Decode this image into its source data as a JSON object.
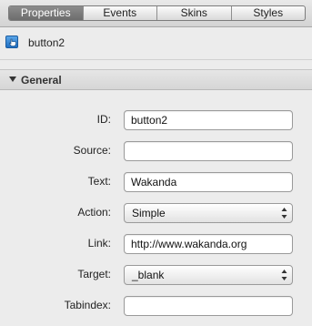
{
  "tabs": [
    {
      "label": "Properties",
      "active": true
    },
    {
      "label": "Events",
      "active": false
    },
    {
      "label": "Skins",
      "active": false
    },
    {
      "label": "Styles",
      "active": false
    }
  ],
  "element": {
    "name": "button2",
    "icon": "button-widget-icon"
  },
  "section": {
    "title": "General",
    "expanded": true
  },
  "fields": {
    "id": {
      "label": "ID:",
      "value": "button2"
    },
    "source": {
      "label": "Source:",
      "value": ""
    },
    "text": {
      "label": "Text:",
      "value": "Wakanda"
    },
    "action": {
      "label": "Action:",
      "value": "Simple"
    },
    "link": {
      "label": "Link:",
      "value": "http://www.wakanda.org"
    },
    "target": {
      "label": "Target:",
      "value": "_blank"
    },
    "tabindex": {
      "label": "Tabindex:",
      "value": ""
    }
  },
  "colors": {
    "active_tab": "#777777",
    "icon_blue": "#2f80d0"
  }
}
